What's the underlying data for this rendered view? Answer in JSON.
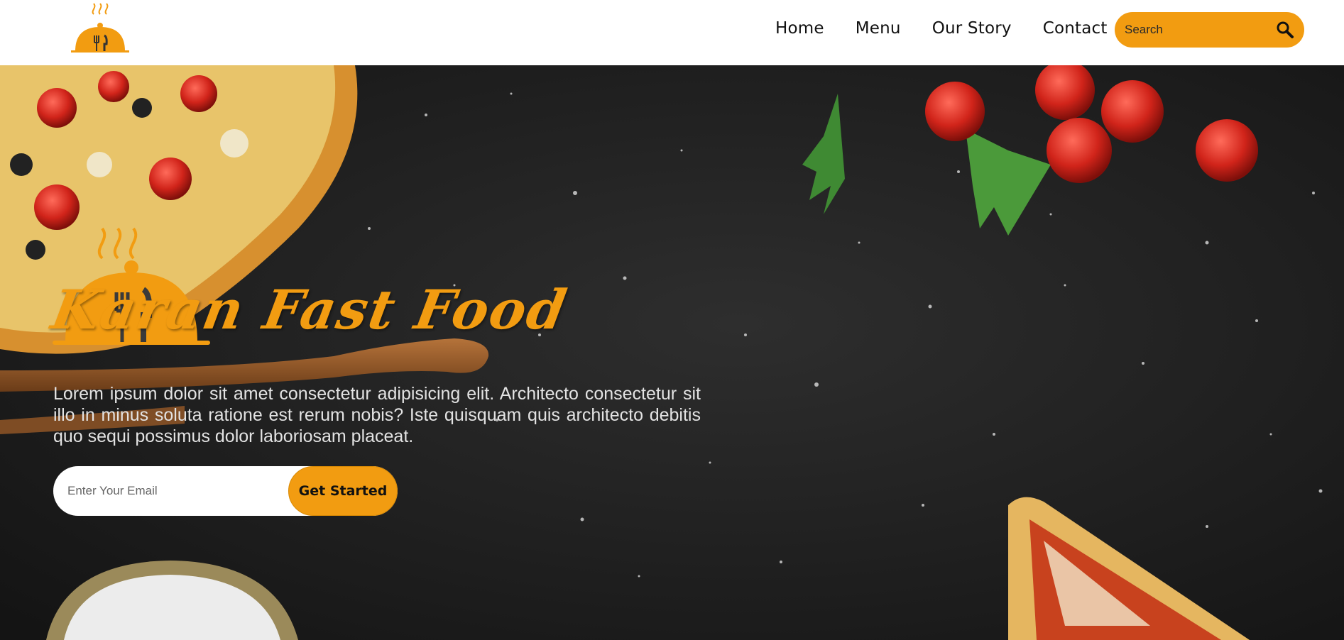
{
  "brand": {
    "accent_color": "#f29c11",
    "logo_icon": "cloche-fork-knife-icon"
  },
  "nav": {
    "items": [
      {
        "label": "Home"
      },
      {
        "label": "Menu"
      },
      {
        "label": "Our Story"
      },
      {
        "label": "Contact"
      }
    ]
  },
  "search": {
    "placeholder": "Search",
    "icon": "search-icon"
  },
  "hero": {
    "title": "Karan Fast Food",
    "description": "Lorem ipsum dolor sit amet consectetur adipisicing elit. Architecto consectetur sit illo in minus soluta ratione est rerum nobis? Iste quisquam quis architecto debitis quo sequi possimus dolor laboriosam placeat.",
    "email_placeholder": "Enter Your Email",
    "cta_label": "Get Started"
  }
}
